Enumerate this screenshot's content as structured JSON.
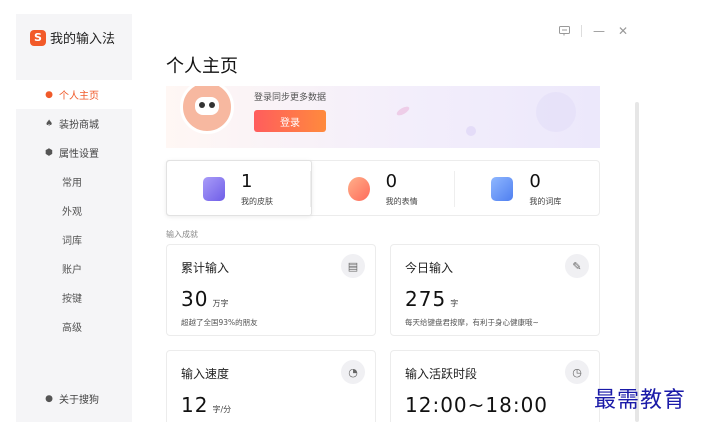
{
  "brand": {
    "logo_letter": "S",
    "title": "我的输入法"
  },
  "sidebar": {
    "items": [
      {
        "label": "个人主页",
        "icon": "person-icon",
        "active": true
      },
      {
        "label": "装扮商城",
        "icon": "shirt-icon"
      },
      {
        "label": "属性设置",
        "icon": "settings-icon"
      }
    ],
    "sub_items": [
      "常用",
      "外观",
      "词库",
      "账户",
      "按键",
      "高级"
    ],
    "bottom_item": {
      "label": "关于搜狗",
      "icon": "info-icon"
    }
  },
  "titlebar": {
    "icons": [
      "feedback-icon",
      "minimize-icon",
      "close-icon"
    ],
    "minimize": "—",
    "close": "✕"
  },
  "page_title": "个人主页",
  "banner": {
    "text": "登录同步更多数据",
    "login_label": "登录"
  },
  "stats": [
    {
      "value": "1",
      "label": "我的皮肤",
      "color": "#7b6cf0"
    },
    {
      "value": "0",
      "label": "我的表情",
      "color": "#ff7a59"
    },
    {
      "value": "0",
      "label": "我的词库",
      "color": "#4f8dfb"
    }
  ],
  "section_label": "输入成就",
  "cards": [
    {
      "title": "累计输入",
      "value": "30",
      "unit": "万字",
      "desc": "超越了全国93%的朋友",
      "icon": "document-icon",
      "glyph": "▤"
    },
    {
      "title": "今日输入",
      "value": "275",
      "unit": "字",
      "desc": "每天给键盘君按摩，有利于身心健康哦~",
      "icon": "edit-icon",
      "glyph": "✎"
    },
    {
      "title": "输入速度",
      "value": "12",
      "unit": "字/分",
      "desc": "",
      "icon": "timer-icon",
      "glyph": "◔"
    },
    {
      "title": "输入活跃时段",
      "value": "12:00~18:00",
      "unit": "",
      "desc": "",
      "icon": "clock-icon",
      "glyph": "◷"
    }
  ],
  "watermark": "最需教育",
  "colors": {
    "accent": "#f05a2a",
    "watermark": "#1a1aa8"
  }
}
